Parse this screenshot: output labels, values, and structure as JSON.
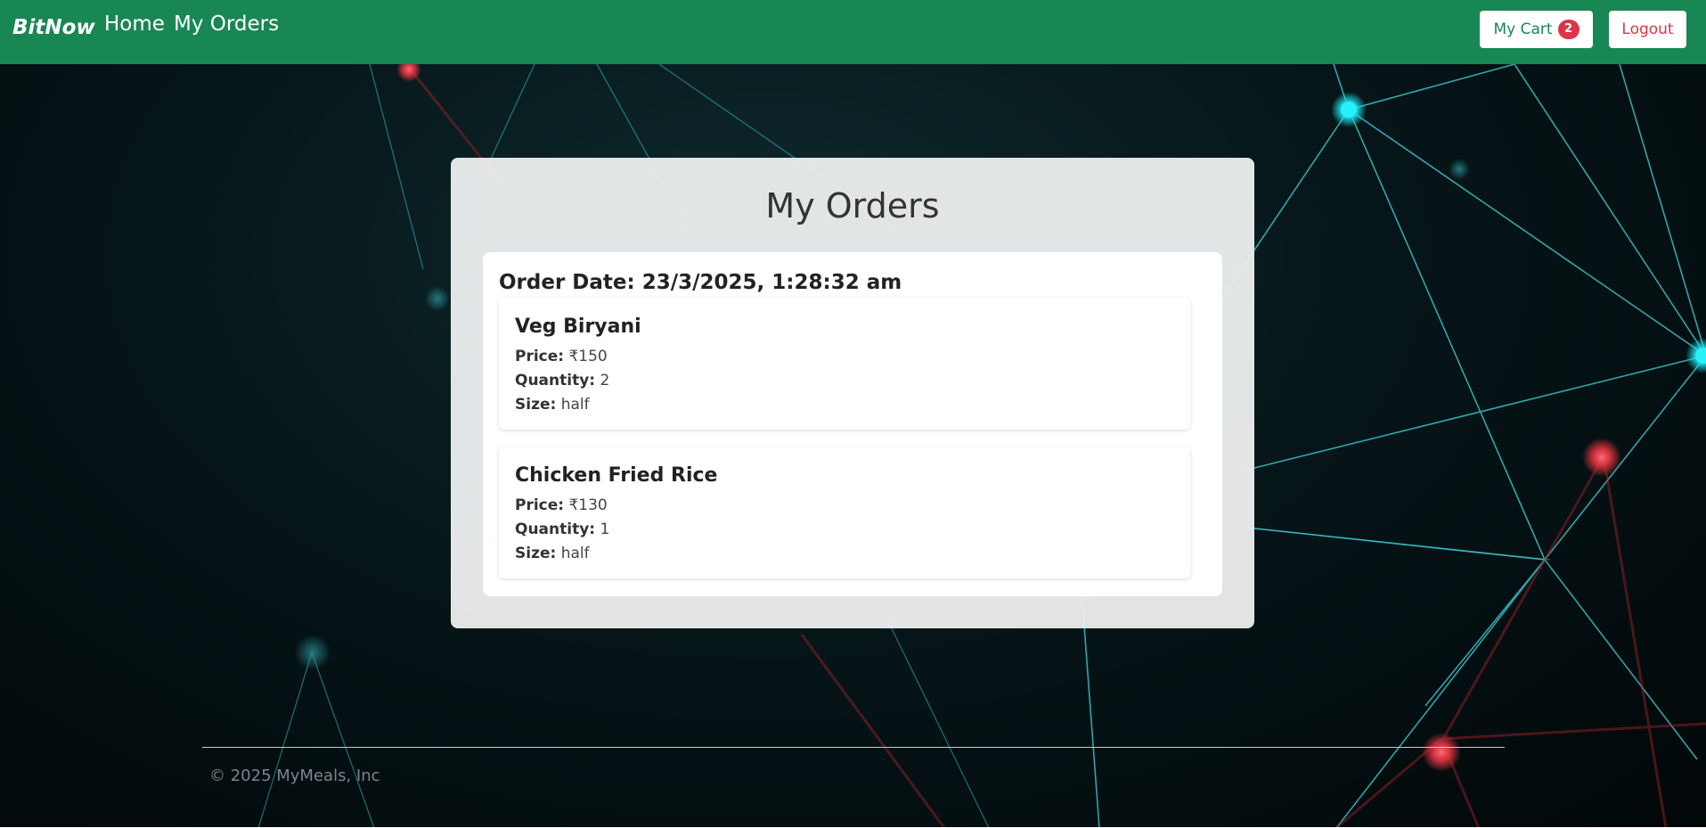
{
  "navbar": {
    "brand": "BitNow",
    "links": [
      {
        "label": "Home"
      },
      {
        "label": "My Orders"
      }
    ],
    "cart_label": "My Cart",
    "cart_count": "2",
    "logout_label": "Logout"
  },
  "main": {
    "title": "My Orders",
    "orders": [
      {
        "date_label": "Order Date: 23/3/2025, 1:28:32 am",
        "items": [
          {
            "name": "Veg Biryani",
            "price_label": "Price:",
            "price": "₹150",
            "quantity_label": "Quantity:",
            "quantity": "2",
            "size_label": "Size:",
            "size": "half"
          },
          {
            "name": "Chicken Fried Rice",
            "price_label": "Price:",
            "price": "₹130",
            "quantity_label": "Quantity:",
            "quantity": "1",
            "size_label": "Size:",
            "size": "half"
          }
        ]
      }
    ]
  },
  "footer": {
    "copyright": "© 2025 MyMeals, Inc"
  },
  "colors": {
    "navbar": "#198754",
    "badge": "#dc3545",
    "logout_text": "#dc3545",
    "cart_text": "#198754",
    "background": "#061619",
    "network_line": "#3fd6e0",
    "network_node_red": "#e0343f"
  }
}
